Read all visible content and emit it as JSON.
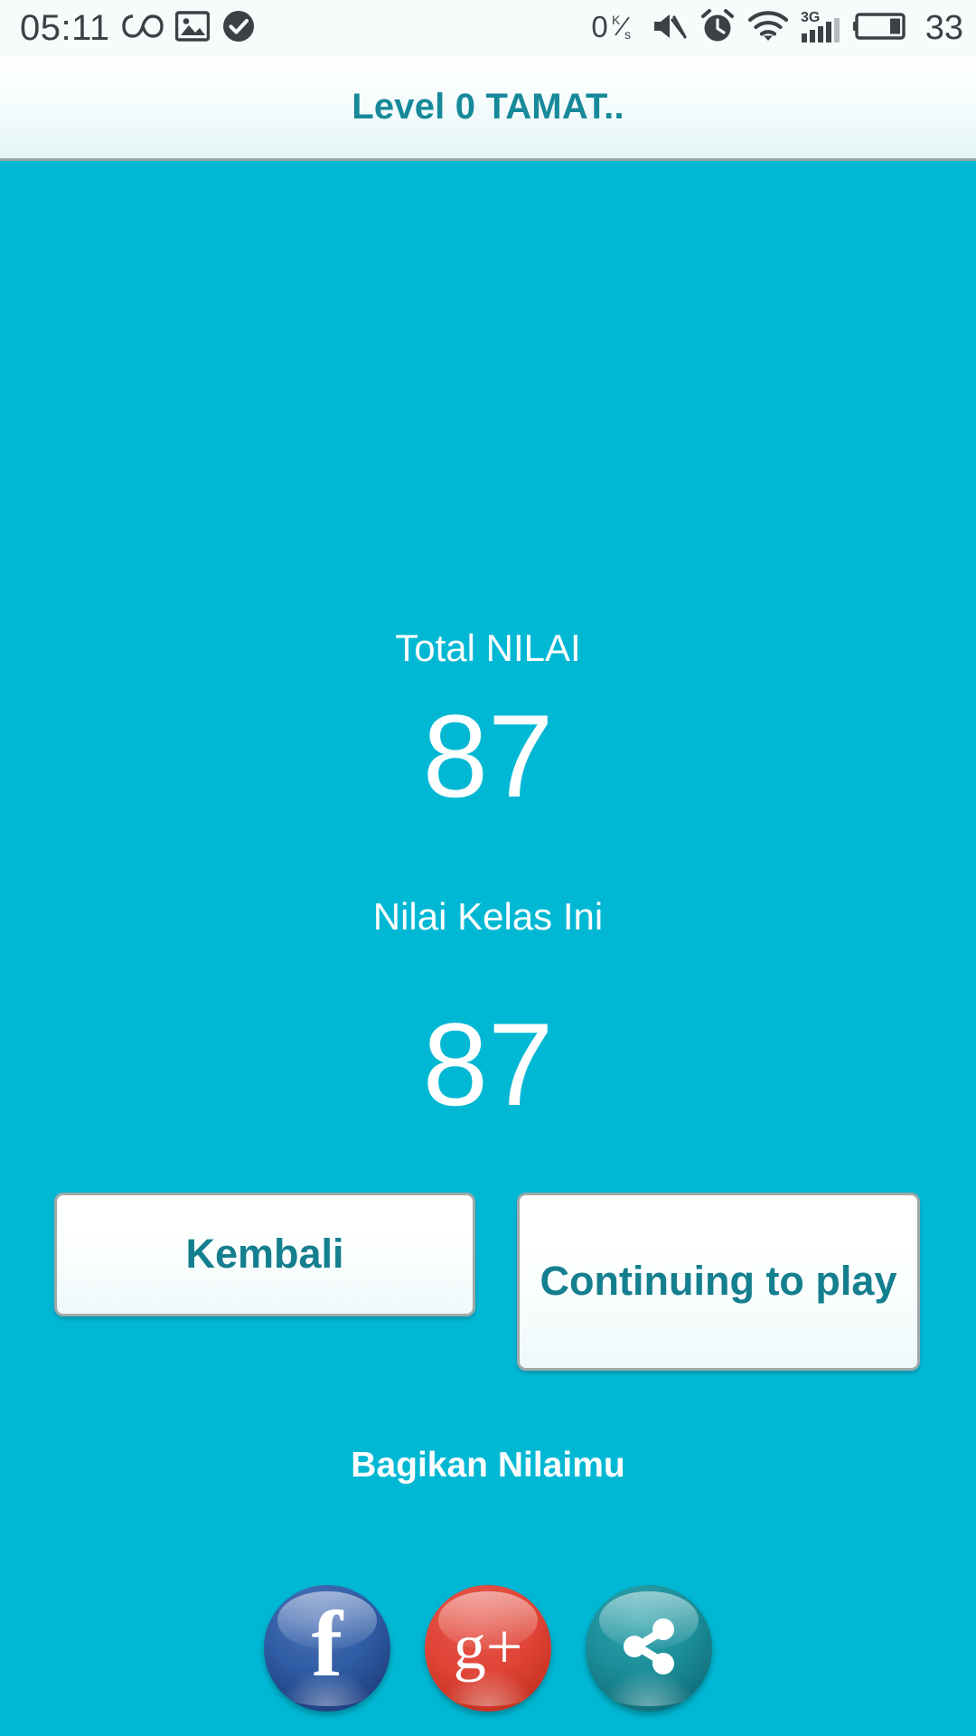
{
  "statusbar": {
    "time": "05:11",
    "left_icons": [
      "infinity-icon",
      "photo-icon",
      "check-circle-icon"
    ],
    "network_rate": "0",
    "network_rate_unit_top": "K",
    "network_rate_unit_bottom": "s",
    "right_icons": [
      "volume-mute-icon",
      "alarm-clock-icon",
      "wifi-icon",
      "signal-3g-icon",
      "battery-icon"
    ],
    "signal_label": "3G",
    "battery_percent": "33"
  },
  "titlebar": {
    "title": "Level 0 TAMAT.."
  },
  "main": {
    "total_label": "Total NILAI",
    "total_value": "87",
    "class_label": "Nilai Kelas Ini",
    "class_value": "87",
    "back_button": "Kembali",
    "continue_button": "Continuing to play",
    "share_label": "Bagikan Nilaimu"
  },
  "share": {
    "facebook_glyph": "f",
    "googleplus_glyph": "g+",
    "items": [
      "facebook-share-button",
      "googleplus-share-button",
      "generic-share-button"
    ]
  },
  "colors": {
    "background": "#00b8d4",
    "accent_teal": "#147f8e",
    "title_teal": "#16899a",
    "facebook_blue": "#2f5ca4",
    "googleplus_red": "#df4436",
    "share_teal": "#1b8e99"
  }
}
